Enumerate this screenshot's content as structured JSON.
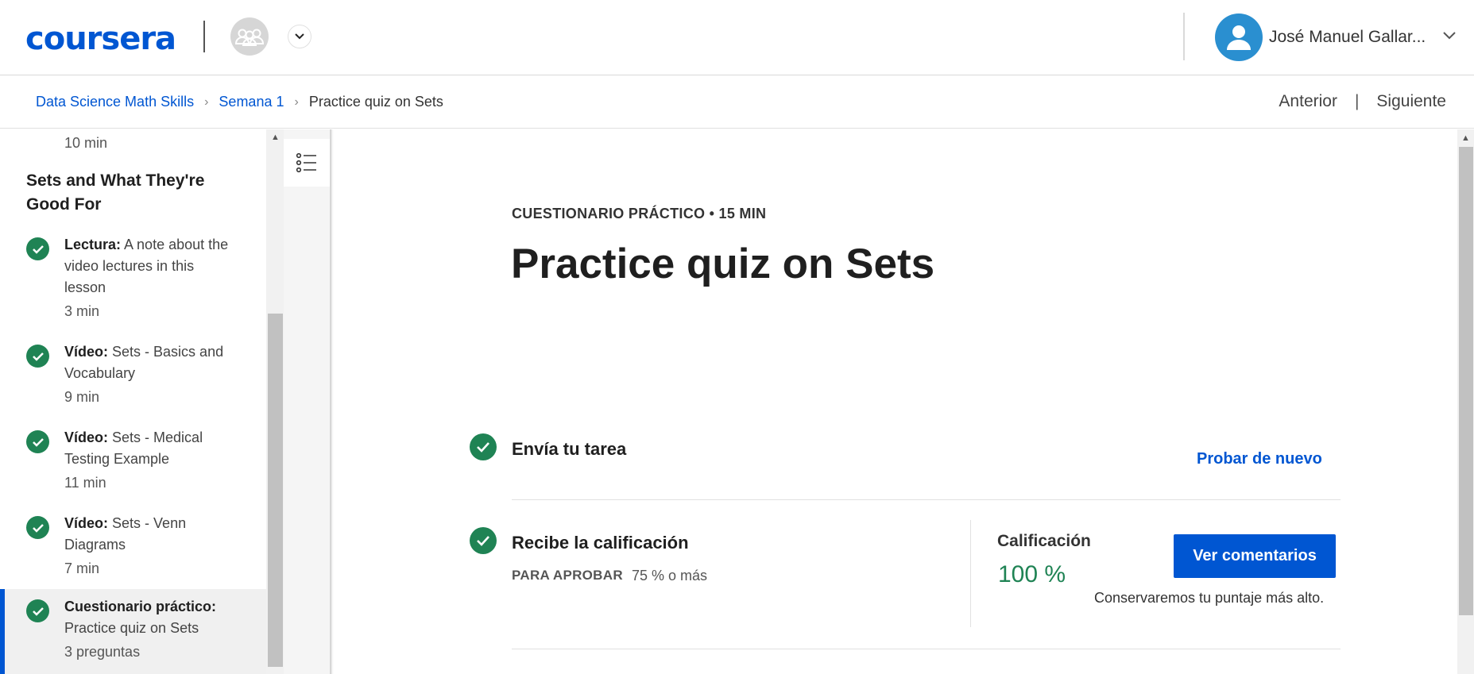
{
  "header": {
    "logo": "coursera",
    "user_name": "José Manuel Gallar...",
    "icons": [
      "group-icon",
      "chevron-down-icon",
      "user-icon"
    ]
  },
  "breadcrumb": {
    "items": [
      "Data Science Math Skills",
      "Semana 1"
    ],
    "current": "Practice quiz on Sets",
    "prev_label": "Anterior",
    "separator": "|",
    "next_label": "Siguiente"
  },
  "sidebar": {
    "first_item_duration": "10 min",
    "section_title": "Sets and What They're Good For",
    "items": [
      {
        "type": "Lectura:",
        "title": "A note about the video lectures in this lesson",
        "duration": "3 min"
      },
      {
        "type": "Vídeo:",
        "title": "Sets - Basics and Vocabulary",
        "duration": "9 min"
      },
      {
        "type": "Vídeo:",
        "title": "Sets - Medical Testing Example",
        "duration": "11 min"
      },
      {
        "type": "Vídeo:",
        "title": "Sets - Venn Diagrams",
        "duration": "7 min"
      },
      {
        "type": "Cuestionario práctico:",
        "title": "Practice quiz on Sets",
        "duration": "3 preguntas"
      }
    ]
  },
  "main": {
    "kicker": "CUESTIONARIO PRÁCTICO • 15 MIN",
    "title": "Practice quiz on Sets",
    "submit": {
      "title": "Envía tu tarea",
      "retry_label": "Probar de nuevo"
    },
    "grade": {
      "title": "Recibe la calificación",
      "pass_label": "PARA APROBAR",
      "pass_value": "75 % o más",
      "grade_label": "Calificación",
      "grade_value": "100 %",
      "feedback_button": "Ver comentarios",
      "keep_note": "Conservaremos tu puntaje más alto."
    }
  },
  "colors": {
    "accent": "#0056d2",
    "success": "#1f8354",
    "avatar": "#2a8fd0"
  }
}
